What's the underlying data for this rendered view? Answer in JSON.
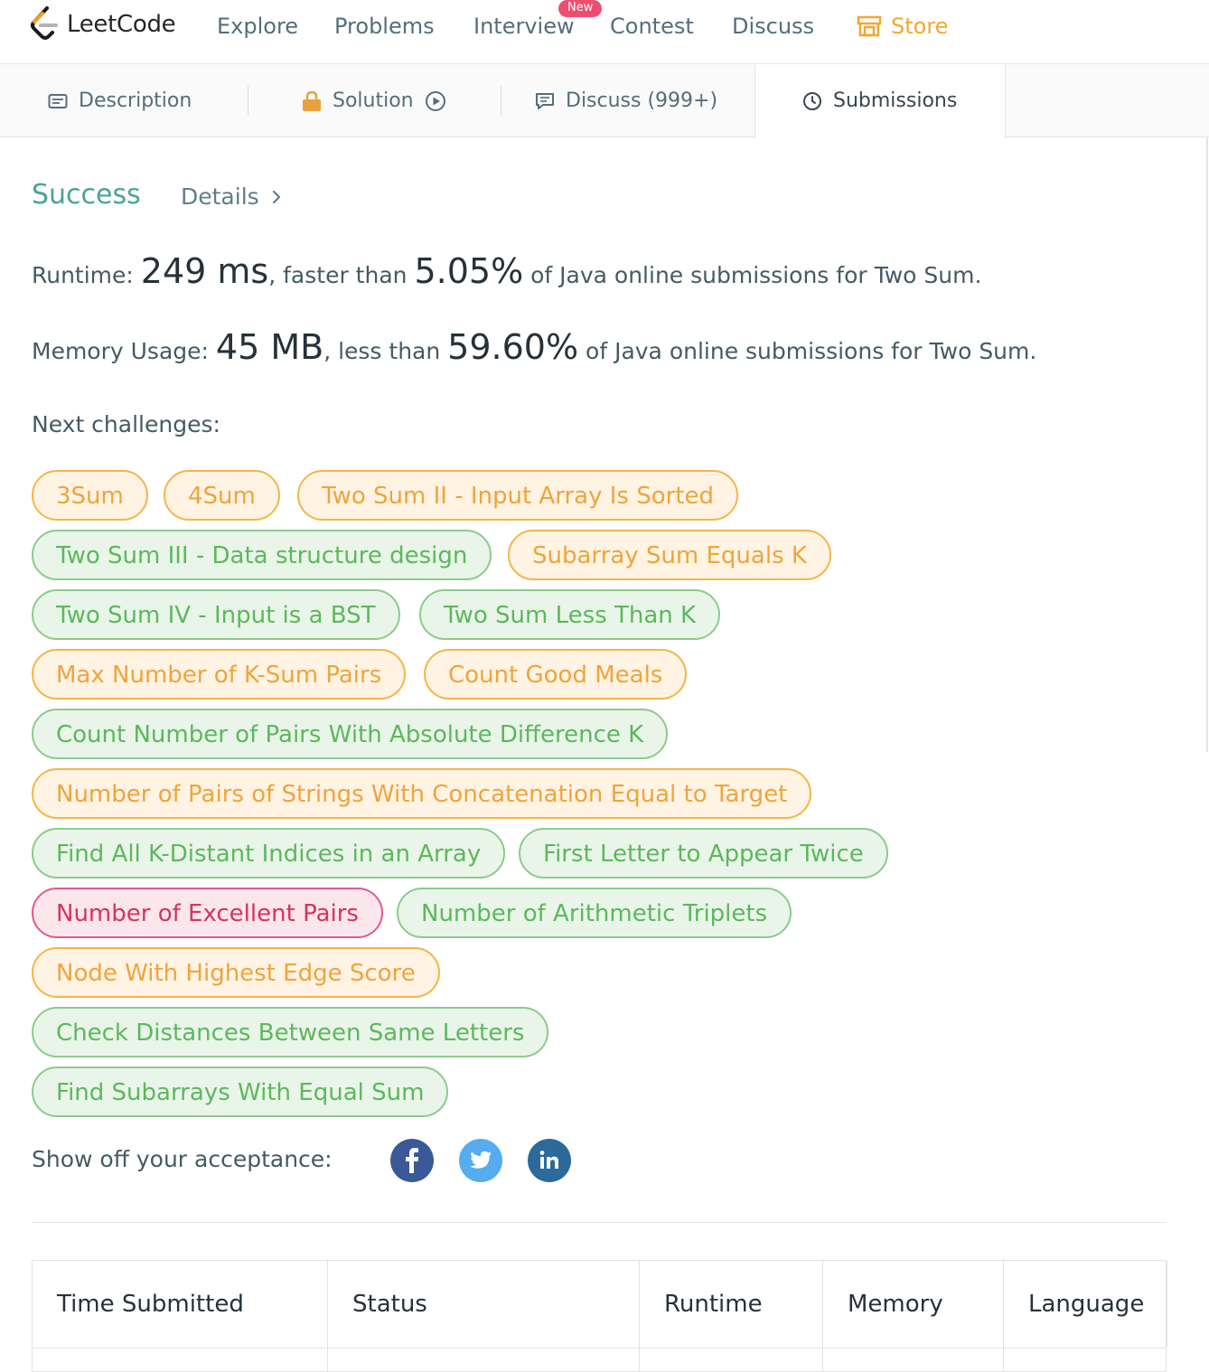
{
  "nav": {
    "brand": "LeetCode",
    "items": [
      "Explore",
      "Problems",
      "Interview",
      "Contest",
      "Discuss"
    ],
    "new_badge": "New",
    "store": "Store",
    "store_color": "#f0a830"
  },
  "tabs": {
    "description": "Description",
    "solution": "Solution",
    "discuss": "Discuss (999+)",
    "submissions": "Submissions",
    "active": "Submissions"
  },
  "result": {
    "status": "Success",
    "details": "Details"
  },
  "runtime": {
    "label": "Runtime:",
    "value": "249 ms",
    "comparison": ", faster than ",
    "percent": "5.05%",
    "suffix": " of Java online submissions for Two Sum."
  },
  "memory": {
    "label": "Memory Usage:",
    "value": "45 MB",
    "comparison": ", less than ",
    "percent": "59.60%",
    "suffix": " of Java online submissions for Two Sum."
  },
  "next_challenges": {
    "title": "Next challenges:",
    "items": [
      {
        "label": "3Sum",
        "difficulty": "medium"
      },
      {
        "label": "4Sum",
        "difficulty": "medium"
      },
      {
        "label": "Two Sum II - Input Array Is Sorted",
        "difficulty": "medium"
      },
      {
        "label": "Two Sum III - Data structure design",
        "difficulty": "easy"
      },
      {
        "label": "Subarray Sum Equals K",
        "difficulty": "medium"
      },
      {
        "label": "Two Sum IV - Input is a BST",
        "difficulty": "easy"
      },
      {
        "label": "Two Sum Less Than K",
        "difficulty": "easy"
      },
      {
        "label": "Max Number of K-Sum Pairs",
        "difficulty": "medium"
      },
      {
        "label": "Count Good Meals",
        "difficulty": "medium"
      },
      {
        "label": "Count Number of Pairs With Absolute Difference K",
        "difficulty": "easy"
      },
      {
        "label": "Number of Pairs of Strings With Concatenation Equal to Target",
        "difficulty": "medium"
      },
      {
        "label": "Find All K-Distant Indices in an Array",
        "difficulty": "easy"
      },
      {
        "label": "First Letter to Appear Twice",
        "difficulty": "easy"
      },
      {
        "label": "Number of Excellent Pairs",
        "difficulty": "hard"
      },
      {
        "label": "Number of Arithmetic Triplets",
        "difficulty": "easy"
      },
      {
        "label": "Node With Highest Edge Score",
        "difficulty": "medium"
      },
      {
        "label": "Check Distances Between Same Letters",
        "difficulty": "easy"
      },
      {
        "label": "Find Subarrays With Equal Sum",
        "difficulty": "easy"
      }
    ]
  },
  "share": {
    "label": "Show off your acceptance:",
    "networks": [
      {
        "name": "facebook-icon",
        "color": "#3b5998"
      },
      {
        "name": "twitter-icon",
        "color": "#55acee"
      },
      {
        "name": "linkedin-icon",
        "color": "#2b6a9a"
      }
    ]
  },
  "table": {
    "headers": [
      "Time Submitted",
      "Status",
      "Runtime",
      "Memory",
      "Language"
    ]
  }
}
